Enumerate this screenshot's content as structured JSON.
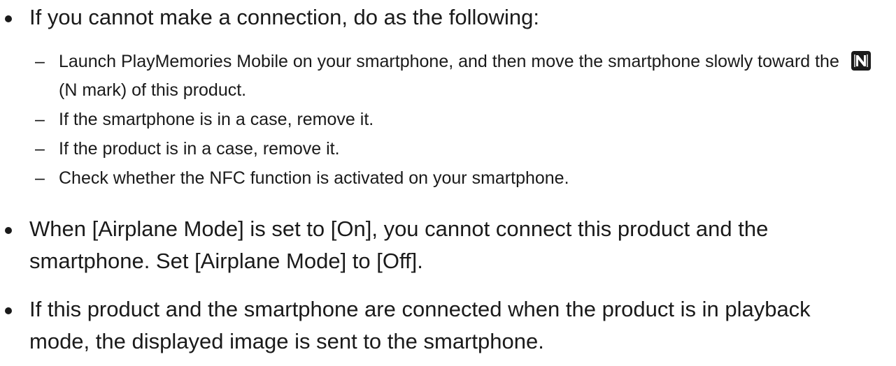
{
  "bullets": [
    {
      "text": "If you cannot make a connection, do as the following:",
      "sub_items": [
        {
          "text_before": "Launch PlayMemories Mobile on your smartphone, and then move the smartphone slowly toward the",
          "icon": "n-mark-icon",
          "text_after": "(N mark) of this product."
        },
        {
          "text": "If the smartphone is in a case, remove it."
        },
        {
          "text": "If the product is in a case, remove it."
        },
        {
          "text": "Check whether the NFC function is activated on your smartphone."
        }
      ]
    },
    {
      "text": "When [Airplane Mode] is set to [On], you cannot connect this product and the smartphone. Set [Airplane Mode] to [Off]."
    },
    {
      "text": "If this product and the smartphone are connected when the product is in playback mode, the displayed image is sent to the smartphone."
    }
  ],
  "sub_item_marker": "–"
}
